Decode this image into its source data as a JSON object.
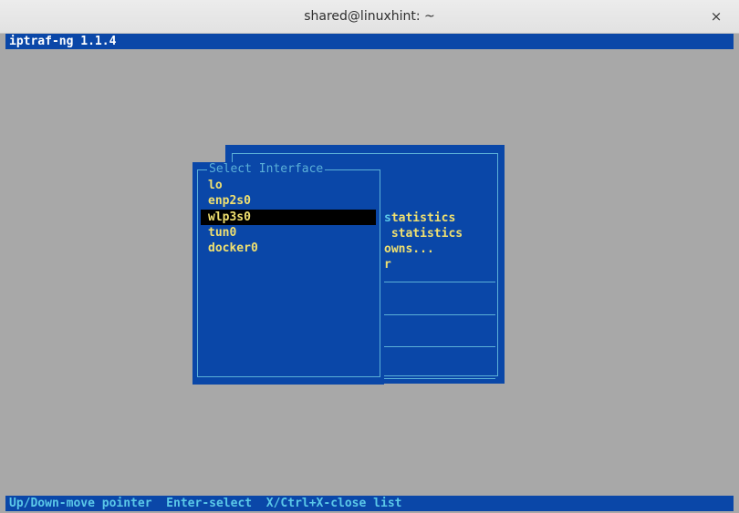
{
  "window": {
    "title": "shared@linuxhint: ~",
    "close_glyph": "×"
  },
  "app": {
    "title": "iptraf-ng 1.1.4"
  },
  "main_menu": {
    "items": [
      {
        "highlight": "s",
        "rest": "tatistics"
      },
      {
        "highlight": "",
        "rest": " statistics"
      },
      {
        "highlight": "",
        "rest": "owns..."
      },
      {
        "highlight": "",
        "rest": "r"
      }
    ]
  },
  "dialog": {
    "title": "Select Interface",
    "interfaces": [
      "lo",
      "enp2s0",
      "wlp3s0",
      "tun0",
      "docker0"
    ],
    "selected_index": 2
  },
  "status_bar": {
    "text": "Up/Down-move pointer  Enter-select  X/Ctrl+X-close list"
  },
  "colors": {
    "panel_blue": "#0a47a8",
    "text_yellow": "#f0e070",
    "text_cyan": "#5bc8e8",
    "border_cyan": "#5bb0d8",
    "terminal_gray": "#a8a8a8"
  }
}
